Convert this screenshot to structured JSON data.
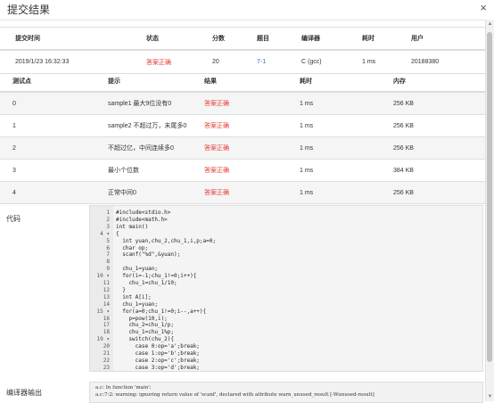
{
  "title": "提交结果",
  "close_glyph": "×",
  "submission": {
    "headers": [
      "提交时间",
      "状态",
      "分数",
      "题目",
      "编译器",
      "耗时",
      "用户"
    ],
    "row": {
      "time": "2019/1/23 16:32:33",
      "status": "答案正确",
      "score": "20",
      "problem": "7-1",
      "compiler": "C (gcc)",
      "elapsed": "1 ms",
      "user": "20188380"
    }
  },
  "cases": {
    "headers": [
      "测试点",
      "提示",
      "结果",
      "耗时",
      "内存"
    ],
    "rows": [
      {
        "id": "0",
        "hint": "sample1 最大9位没有0",
        "result": "答案正确",
        "time": "1 ms",
        "memory": "256 KB"
      },
      {
        "id": "1",
        "hint": "sample2 不超过万，末尾多0",
        "result": "答案正确",
        "time": "1 ms",
        "memory": "256 KB"
      },
      {
        "id": "2",
        "hint": "不超过亿，中间连续多0",
        "result": "答案正确",
        "time": "1 ms",
        "memory": "256 KB"
      },
      {
        "id": "3",
        "hint": "最小个位数",
        "result": "答案正确",
        "time": "1 ms",
        "memory": "384 KB"
      },
      {
        "id": "4",
        "hint": "正常中间0",
        "result": "答案正确",
        "time": "1 ms",
        "memory": "256 KB"
      }
    ]
  },
  "code_label": "代码",
  "code_lines": [
    {
      "n": "1",
      "text": "#include<stdio.h>"
    },
    {
      "n": "2",
      "text": "#include<math.h>"
    },
    {
      "n": "3",
      "text": "int main()"
    },
    {
      "n": "4 ▾",
      "text": "{"
    },
    {
      "n": "5",
      "text": "  int yuan,chu_2,chu_1,i,p;a=0;"
    },
    {
      "n": "6",
      "text": "  char op;"
    },
    {
      "n": "7",
      "text": "  scanf(\"%d\",&yuan);"
    },
    {
      "n": "8",
      "text": ""
    },
    {
      "n": "9",
      "text": "  chu_1=yuan;"
    },
    {
      "n": "10 ▾",
      "text": "  for(i=-1;chu_1!=0;i++){"
    },
    {
      "n": "11",
      "text": "    chu_1=chu_1/10;"
    },
    {
      "n": "12",
      "text": "  }"
    },
    {
      "n": "13",
      "text": "  int A[i];"
    },
    {
      "n": "14",
      "text": "  chu_1=yuan;"
    },
    {
      "n": "15 ▾",
      "text": "  for(a=0;chu_1!=0;i--,a++){"
    },
    {
      "n": "16",
      "text": "    p=pow(10,i);"
    },
    {
      "n": "17",
      "text": "    chu_2=chu_1/p;"
    },
    {
      "n": "18",
      "text": "    chu_1=chu_1%p;"
    },
    {
      "n": "19 ▾",
      "text": "    switch(chu_2){"
    },
    {
      "n": "20",
      "text": "      case 0:op='a';break;"
    },
    {
      "n": "21",
      "text": "      case 1:op='b';break;"
    },
    {
      "n": "22",
      "text": "      case 2:op='c';break;"
    },
    {
      "n": "23",
      "text": "      case 3:op='d';break;"
    }
  ],
  "compiler_label": "编译器输出",
  "compiler_output": [
    "a.c: In function 'main':",
    "a.c:7:2: warning: ignoring return value of 'scanf', declared with attribute warn_unused_result [-Wunused-result]"
  ],
  "colors": {
    "status_accent": "#e53935",
    "link": "#2f6fb5"
  }
}
